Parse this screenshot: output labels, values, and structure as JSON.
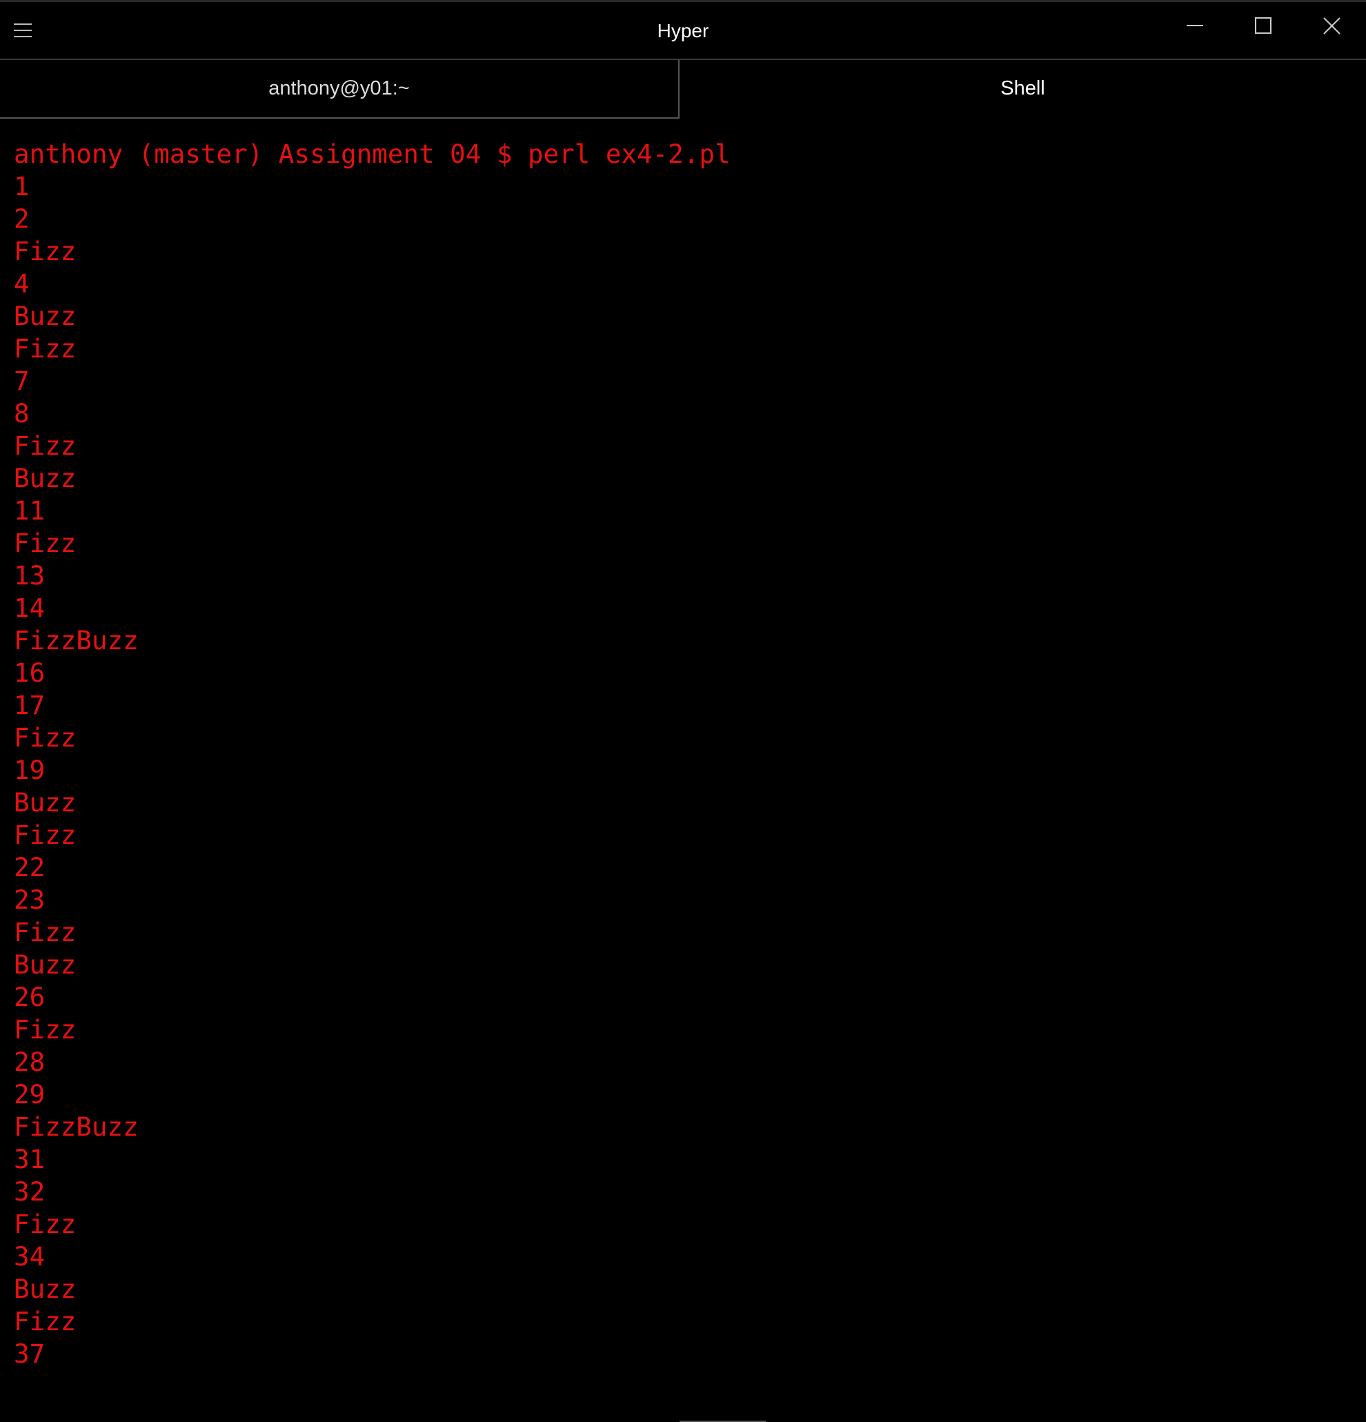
{
  "window": {
    "title": "Hyper"
  },
  "tabs": [
    {
      "label": "anthony@y01:~"
    },
    {
      "label": "Shell"
    }
  ],
  "terminal": {
    "lines": [
      "anthony (master) Assignment 04 $ perl ex4-2.pl",
      "1",
      "2",
      "Fizz",
      "4",
      "Buzz",
      "Fizz",
      "7",
      "8",
      "Fizz",
      "Buzz",
      "11",
      "Fizz",
      "13",
      "14",
      "FizzBuzz",
      "16",
      "17",
      "Fizz",
      "19",
      "Buzz",
      "Fizz",
      "22",
      "23",
      "Fizz",
      "Buzz",
      "26",
      "Fizz",
      "28",
      "29",
      "FizzBuzz",
      "31",
      "32",
      "Fizz",
      "34",
      "Buzz",
      "Fizz",
      "37"
    ],
    "text_color": "#e61010"
  }
}
